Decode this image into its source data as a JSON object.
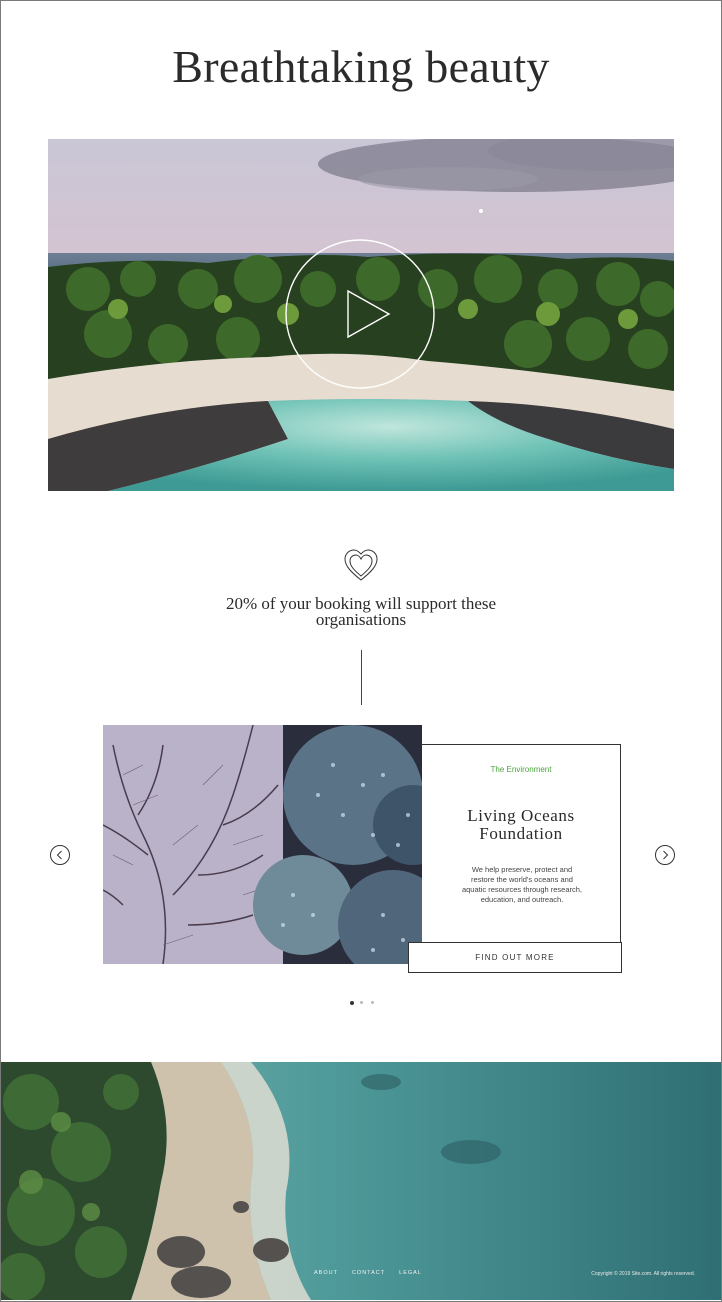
{
  "page": {
    "title": "Breathtaking beauty"
  },
  "video": {
    "image": "aerial-island-beach-at-dusk",
    "play_icon": "play-icon"
  },
  "support": {
    "icon": "heart-icon",
    "line1": "20% of your booking will support these",
    "line2": "organisations"
  },
  "carousel": {
    "prev_icon": "chevron-left-icon",
    "next_icon": "chevron-right-icon",
    "slide": {
      "image": "coral-reef-closeup",
      "category": "The Environment",
      "title_line1": "Living Oceans",
      "title_line2": "Foundation",
      "desc_line1": "We help preserve, protect and",
      "desc_line2": "restore the world's oceans and",
      "desc_line3": "aquatic resources through research,",
      "desc_line4": "education, and outreach.",
      "cta": "FIND OUT MORE"
    },
    "page_count": 3,
    "active_page": 1
  },
  "footer": {
    "background": "aerial-beach-and-turquoise-water",
    "links": [
      "ABOUT",
      "CONTACT",
      "LEGAL"
    ],
    "copyright": "Copyright © 2019 Site.com. All rights reserved."
  },
  "colors": {
    "accent_green": "#4aa33c",
    "text": "#2a2a2a"
  }
}
